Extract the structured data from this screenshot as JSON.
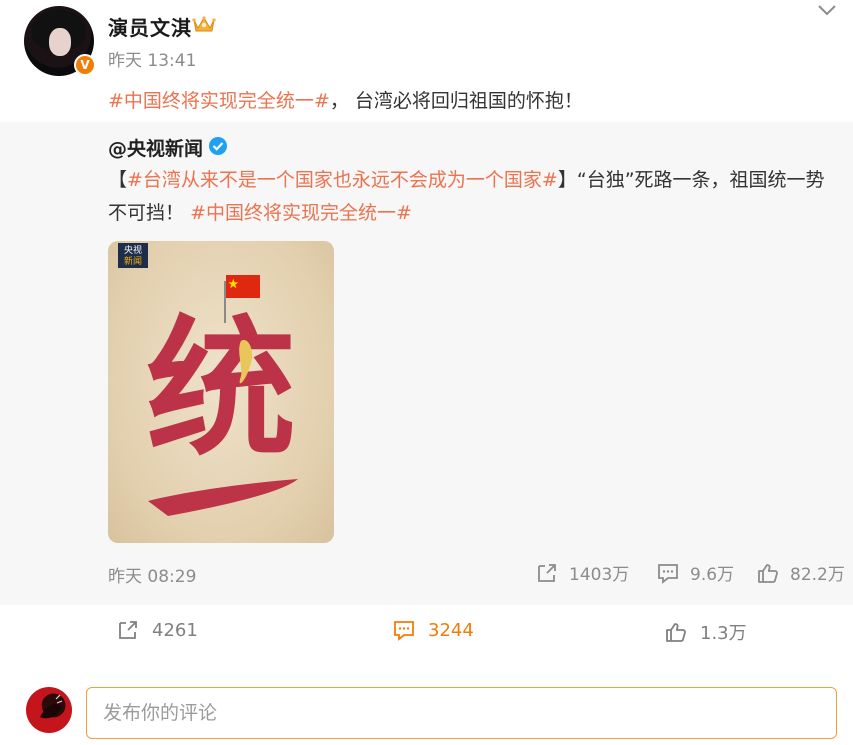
{
  "post": {
    "username": "演员文淇",
    "time": "昨天 13:41",
    "hashtag": "#中国终将实现完全统一#",
    "text": "， 台湾必将回归祖国的怀抱！",
    "badge": "V"
  },
  "repost": {
    "author": "@央视新闻",
    "bracket_open": "【",
    "hashtag1": "#台湾从来不是一个国家也永远不会成为一个国家#",
    "text1": "】“台独”死路一条，祖国统一势不可挡！",
    "hashtag2": "#中国终将实现完全统一#",
    "image": {
      "logo_line1": "央视",
      "logo_line2": "新闻",
      "calligraphy_char1": "统",
      "calligraphy_char2": "一"
    },
    "time": "昨天 08:29",
    "stats": {
      "reposts": "1403万",
      "comments": "9.6万",
      "likes": "82.2万"
    }
  },
  "actions": {
    "reposts": "4261",
    "comments": "3244",
    "likes": "1.3万"
  },
  "comment_box": {
    "placeholder": "发布你的评论"
  },
  "colors": {
    "hashtag": "#eb7350",
    "accent": "#f07d07",
    "verified_blue": "#1da1f2"
  }
}
